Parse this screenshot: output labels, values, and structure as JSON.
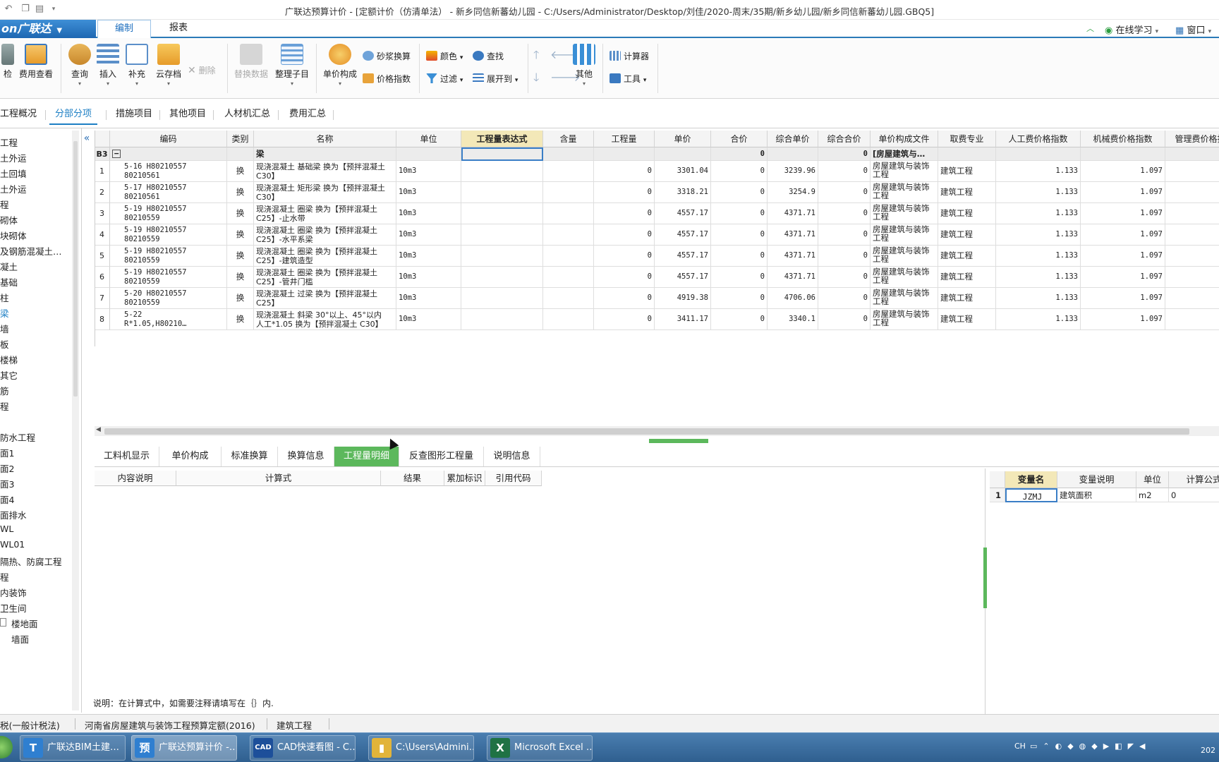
{
  "window": {
    "title": "广联达预算计价 - [定额计价（仿清单法） - 新乡同信新蕃幼儿园 - C:/Users/Administrator/Desktop/刘佳/2020-周末/35期/新乡幼儿园/新乡同信新蕃幼儿园.GBQ5]"
  },
  "menu": {
    "logo": "on广联达",
    "tabs": [
      "编制",
      "报表"
    ],
    "right": {
      "learn": "在线学习",
      "window": "窗口"
    }
  },
  "ribbon": {
    "check": "检",
    "fee_view": "费用查看",
    "query": "查询",
    "insert": "插入",
    "supplement": "补充",
    "cloud": "云存档",
    "delete": "删除",
    "replace": "替换数据",
    "organize": "整理子目",
    "price_comp": "单价构成",
    "mortar": "砂浆换算",
    "price_index": "价格指数",
    "color": "颜色",
    "find": "查找",
    "filter": "过滤",
    "expand": "展开到",
    "other": "其他",
    "calculator": "计算器",
    "tools": "工具"
  },
  "page_tabs": [
    "工程概况",
    "分部分项",
    "措施项目",
    "其他项目",
    "人材机汇总",
    "费用汇总"
  ],
  "tree": {
    "items": [
      "工程",
      "土外运",
      "土回填",
      "土外运",
      "程",
      "砌体",
      "块砌体",
      "及钢筋混凝土…",
      "凝土",
      "基础",
      "柱",
      "梁",
      "墙",
      "板",
      "楼梯",
      "其它",
      "筋",
      "程",
      "",
      "防水工程",
      "面1",
      "面2",
      "面3",
      "面4",
      "面排水",
      "WL",
      "WL01",
      "隔热、防腐工程",
      "程",
      "内装饰",
      "卫生间",
      "楼地面",
      "墙面"
    ]
  },
  "grid": {
    "headers": [
      "编码",
      "类别",
      "名称",
      "单位",
      "工程量表达式",
      "含量",
      "工程量",
      "单价",
      "合价",
      "综合单价",
      "综合合价",
      "单价构成文件",
      "取费专业",
      "人工费价格指数",
      "机械费价格指数",
      "管理费价格指"
    ],
    "b3": {
      "label": "B3",
      "name": "梁",
      "hejia": "0",
      "zhhj": "0",
      "file": "[房屋建筑与…"
    },
    "rows": [
      {
        "no": "1",
        "code1": "5-16 H80210557",
        "code2": "80210561",
        "type": "换",
        "name1": "现浇混凝土 基础梁  换为【预拌混凝土",
        "name2": "C30】",
        "unit": "10m3",
        "qty": "0",
        "price": "3301.04",
        "total": "0",
        "zhdj": "3239.96",
        "zhhj": "0",
        "file": "房屋建筑与装饰工程",
        "major": "建筑工程",
        "labor": "1.133",
        "mach": "1.097"
      },
      {
        "no": "2",
        "code1": "5-17 H80210557",
        "code2": "80210561",
        "type": "换",
        "name1": "现浇混凝土 矩形梁  换为【预拌混凝土",
        "name2": "C30】",
        "unit": "10m3",
        "qty": "0",
        "price": "3318.21",
        "total": "0",
        "zhdj": "3254.9",
        "zhhj": "0",
        "file": "房屋建筑与装饰工程",
        "major": "建筑工程",
        "labor": "1.133",
        "mach": "1.097"
      },
      {
        "no": "3",
        "code1": "5-19 H80210557",
        "code2": "80210559",
        "type": "换",
        "name1": "现浇混凝土 圈梁  换为【预拌混凝土",
        "name2": "C25】-止水带",
        "unit": "10m3",
        "qty": "0",
        "price": "4557.17",
        "total": "0",
        "zhdj": "4371.71",
        "zhhj": "0",
        "file": "房屋建筑与装饰工程",
        "major": "建筑工程",
        "labor": "1.133",
        "mach": "1.097"
      },
      {
        "no": "4",
        "code1": "5-19 H80210557",
        "code2": "80210559",
        "type": "换",
        "name1": "现浇混凝土 圈梁  换为【预拌混凝土",
        "name2": "C25】-水平系梁",
        "unit": "10m3",
        "qty": "0",
        "price": "4557.17",
        "total": "0",
        "zhdj": "4371.71",
        "zhhj": "0",
        "file": "房屋建筑与装饰工程",
        "major": "建筑工程",
        "labor": "1.133",
        "mach": "1.097"
      },
      {
        "no": "5",
        "code1": "5-19 H80210557",
        "code2": "80210559",
        "type": "换",
        "name1": "现浇混凝土 圈梁  换为【预拌混凝土",
        "name2": "C25】-建筑造型",
        "unit": "10m3",
        "qty": "0",
        "price": "4557.17",
        "total": "0",
        "zhdj": "4371.71",
        "zhhj": "0",
        "file": "房屋建筑与装饰工程",
        "major": "建筑工程",
        "labor": "1.133",
        "mach": "1.097"
      },
      {
        "no": "6",
        "code1": "5-19 H80210557",
        "code2": "80210559",
        "type": "换",
        "name1": "现浇混凝土 圈梁  换为【预拌混凝土",
        "name2": "C25】-管井门槛",
        "unit": "10m3",
        "qty": "0",
        "price": "4557.17",
        "total": "0",
        "zhdj": "4371.71",
        "zhhj": "0",
        "file": "房屋建筑与装饰工程",
        "major": "建筑工程",
        "labor": "1.133",
        "mach": "1.097"
      },
      {
        "no": "7",
        "code1": "5-20 H80210557",
        "code2": "80210559",
        "type": "换",
        "name1": "现浇混凝土 过梁  换为【预拌混凝土",
        "name2": "C25】",
        "unit": "10m3",
        "qty": "0",
        "price": "4919.38",
        "total": "0",
        "zhdj": "4706.06",
        "zhhj": "0",
        "file": "房屋建筑与装饰工程",
        "major": "建筑工程",
        "labor": "1.133",
        "mach": "1.097"
      },
      {
        "no": "8",
        "code1": "5-22",
        "code2": "R*1.05,H80210…",
        "type": "换",
        "name1": "现浇混凝土 斜梁  30°以上、45°以内",
        "name2": "人工*1.05  换为【预拌混凝土 C30】",
        "unit": "10m3",
        "qty": "0",
        "price": "3411.17",
        "total": "0",
        "zhdj": "3340.1",
        "zhhj": "0",
        "file": "房屋建筑与装饰工程",
        "major": "建筑工程",
        "labor": "1.133",
        "mach": "1.097"
      }
    ],
    "last_col_value": "1"
  },
  "bottom_tabs": [
    "工料机显示",
    "单价构成",
    "标准换算",
    "换算信息",
    "工程量明细",
    "反查图形工程量",
    "说明信息"
  ],
  "detail_headers": [
    "内容说明",
    "计算式",
    "结果",
    "累加标识",
    "引用代码"
  ],
  "var_table": {
    "headers": [
      "变量名",
      "变量说明",
      "单位",
      "计算公式"
    ],
    "rows": [
      {
        "no": "1",
        "name": "JZMJ",
        "desc": "建筑面积",
        "unit": "m2",
        "formula": "0"
      }
    ]
  },
  "note": "说明：在计算式中，如需要注释请填写在｛｝内.",
  "status": {
    "tax": "税(一般计税法)",
    "quota": "河南省房屋建筑与装饰工程预算定额(2016)",
    "major": "建筑工程"
  },
  "taskbar": {
    "items": [
      {
        "label": "广联达BIM土建…",
        "icon": "T",
        "color": "#2f7fd0"
      },
      {
        "label": "广联达预算计价 -…",
        "icon": "预",
        "color": "#2f7fd0"
      },
      {
        "label": "CAD快速看图 - C…",
        "icon": "CAD",
        "color": "#1d4f9a"
      },
      {
        "label": "C:\\Users\\Admini…",
        "icon": "▮",
        "color": "#e2b43a"
      },
      {
        "label": "Microsoft Excel …",
        "icon": "X",
        "color": "#1f7244"
      }
    ],
    "lang": "CH",
    "clock": "202"
  }
}
